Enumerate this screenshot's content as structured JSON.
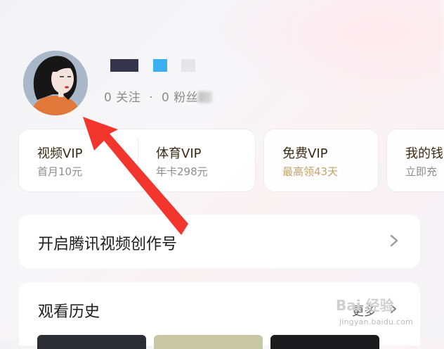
{
  "profile": {
    "follow_count": "0",
    "follow_label": "关注",
    "separator": "·",
    "fans_count": "0",
    "fans_label": "粉丝"
  },
  "vip_cards": [
    {
      "title": "视频VIP",
      "subtitle": "首月10元"
    },
    {
      "title": "体育VIP",
      "subtitle": "年卡298元"
    },
    {
      "title": "免费VIP",
      "subtitle": "最高领43天"
    },
    {
      "title": "我的钱",
      "subtitle": "立即充"
    }
  ],
  "creator": {
    "label": "开启腾讯视频创作号"
  },
  "history": {
    "title": "观看历史",
    "more_label": "更多"
  },
  "watermark": {
    "logo": "Bai 经验",
    "url": "jingyan.baidu.com"
  },
  "colors": {
    "arrow": "#f2362d",
    "gold_text": "#c6a067",
    "name_block_1": "#34344d",
    "name_block_2": "#3ab0f0",
    "name_block_3": "#e6e6e8"
  },
  "icons": [
    "avatar-illustration",
    "chevron-right-icon",
    "annotation-arrow"
  ]
}
